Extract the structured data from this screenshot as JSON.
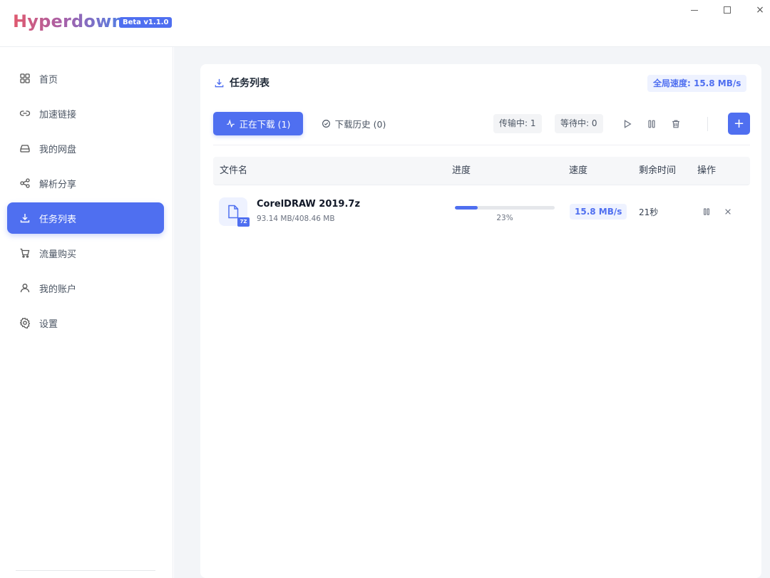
{
  "app": {
    "name": "Hyperdown",
    "badge": "Beta v1.1.0",
    "window_controls": {
      "minimize": "minimize-icon",
      "maximize": "maximize-icon",
      "close": "×"
    }
  },
  "sidebar": {
    "items": [
      {
        "label": "首页",
        "icon": "grid-icon",
        "active": false
      },
      {
        "label": "加速链接",
        "icon": "link-icon",
        "active": false
      },
      {
        "label": "我的网盘",
        "icon": "drive-icon",
        "active": false
      },
      {
        "label": "解析分享",
        "icon": "share-icon",
        "active": false
      },
      {
        "label": "任务列表",
        "icon": "download-icon",
        "active": true
      },
      {
        "label": "流量购买",
        "icon": "cart-icon",
        "active": false
      },
      {
        "label": "我的账户",
        "icon": "user-icon",
        "active": false
      },
      {
        "label": "设置",
        "icon": "gear-icon",
        "active": false
      }
    ]
  },
  "main": {
    "title": "任务列表",
    "global_speed": "全局速度: 15.8 MB/s",
    "tabs": {
      "downloading": "正在下载 (1)",
      "history": "下载历史 (0)"
    },
    "counts": {
      "transferring": "传输中: 1",
      "waiting": "等待中: 0"
    },
    "add_label": "+",
    "table": {
      "headers": {
        "filename": "文件名",
        "progress": "进度",
        "speed": "速度",
        "remaining": "剩余时间",
        "actions": "操作"
      },
      "rows": [
        {
          "name": "CorelDRAW 2019.7z",
          "ext": "7Z",
          "size": "93.14 MB/408.46 MB",
          "progress": 0.23,
          "progress_text": "23%",
          "speed": "15.8 MB/s",
          "remaining": "21秒"
        }
      ]
    }
  },
  "colors": {
    "accent": "#4f6ff0",
    "accent_soft": "#eef2ff"
  }
}
